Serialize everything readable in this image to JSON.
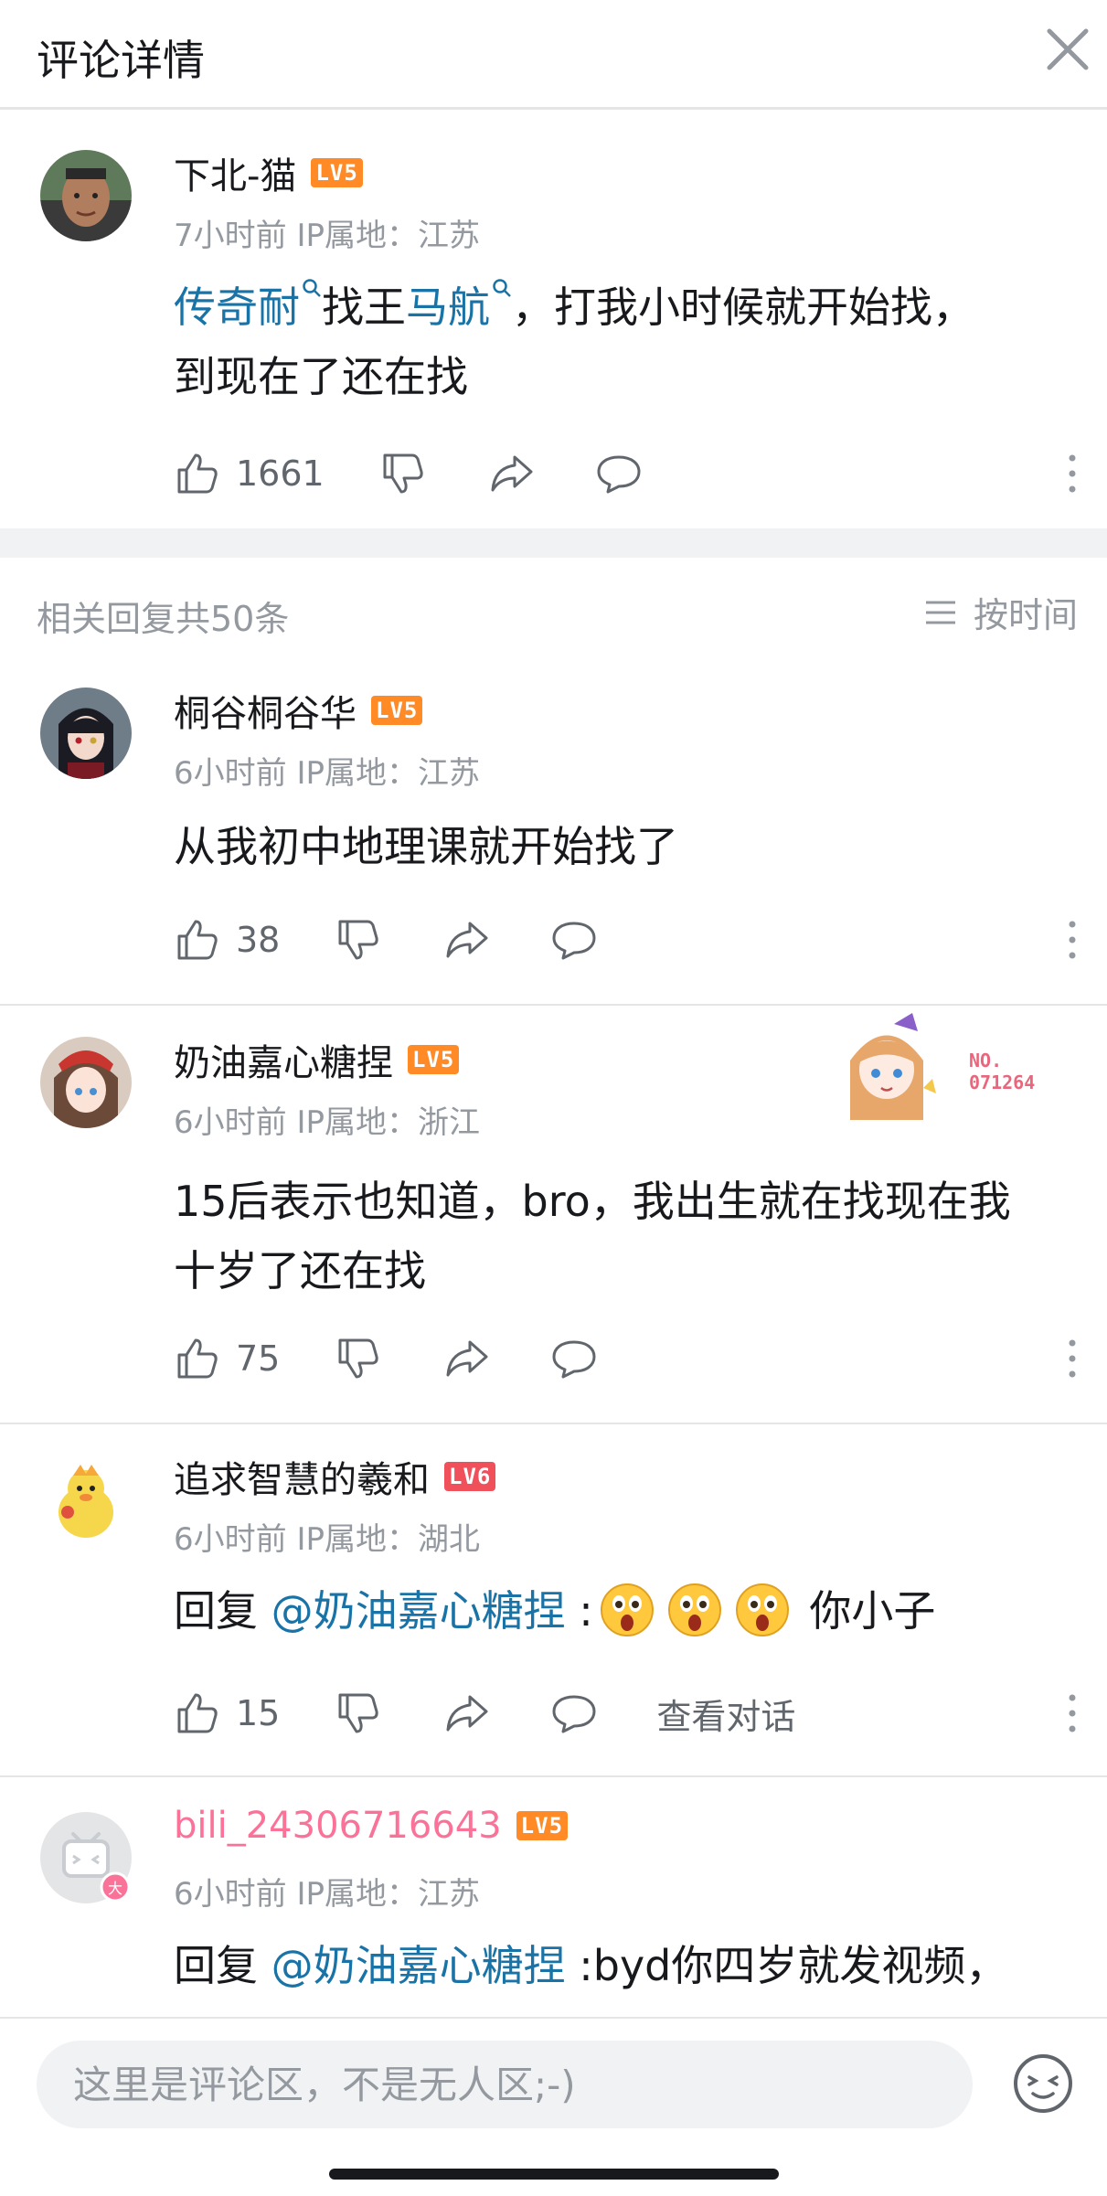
{
  "header": {
    "title": "评论详情"
  },
  "main_comment": {
    "username": "下北-猫",
    "level": "LV5",
    "meta": "7小时前 IP属地：江苏",
    "content_parts": [
      "传奇耐",
      "找王",
      "马航",
      "，打我小时候就开始找，",
      "到现在了还在找"
    ],
    "likes": "1661"
  },
  "replies_header": {
    "count_text": "相关回复共50条",
    "sort_label": "按时间"
  },
  "replies": [
    {
      "username": "桐谷桐谷华",
      "level": "LV5",
      "meta": "6小时前 IP属地：江苏",
      "content": "从我初中地理课就开始找了",
      "likes": "38"
    },
    {
      "username": "奶油嘉心糖捏",
      "level": "LV5",
      "meta": "6小时前 IP属地：浙江",
      "content_line1": "15后表示也知道，bro，我出生就在找现在我",
      "content_line2": "十岁了还在找",
      "likes": "75",
      "badge_no": "NO.",
      "badge_num": "071264"
    },
    {
      "username": "追求智慧的羲和",
      "level": "LV6",
      "meta": "6小时前 IP属地：湖北",
      "reply_prefix": "回复 ",
      "mention": "@奶油嘉心糖捏",
      "sep": " :",
      "content_tail": " 你小子",
      "likes": "15",
      "view_conversation": "查看对话"
    },
    {
      "username": "bili_24306716643",
      "level": "LV5",
      "meta": "6小时前 IP属地：江苏",
      "reply_prefix": "回复 ",
      "mention": "@奶油嘉心糖捏",
      "content_tail": " :byd你四岁就发视频，"
    }
  ],
  "footer": {
    "placeholder": "这里是评论区，不是无人区;-)"
  },
  "colors": {
    "link": "#1a73a6",
    "level5": "#ff8a26",
    "level6": "#f0505a",
    "pink_name": "#fb7299"
  }
}
